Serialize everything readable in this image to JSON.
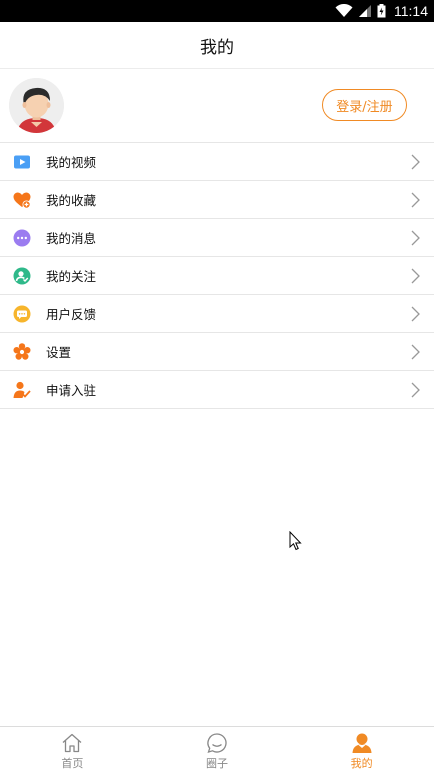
{
  "status_bar": {
    "time": "11:14"
  },
  "header": {
    "title": "我的"
  },
  "profile": {
    "login_label": "登录/注册"
  },
  "menu": {
    "items": [
      {
        "label": "我的视频",
        "icon": "video-play-icon",
        "color": "#4a9ff5"
      },
      {
        "label": "我的收藏",
        "icon": "heart-plus-icon",
        "color": "#f5761a"
      },
      {
        "label": "我的消息",
        "icon": "message-dots-icon",
        "color": "#9b7cf0"
      },
      {
        "label": "我的关注",
        "icon": "user-check-icon",
        "color": "#2fb98a"
      },
      {
        "label": "用户反馈",
        "icon": "feedback-bubble-icon",
        "color": "#f7b52c"
      },
      {
        "label": "设置",
        "icon": "flower-gear-icon",
        "color": "#f5761a"
      },
      {
        "label": "申请入驻",
        "icon": "user-apply-icon",
        "color": "#f5761a"
      }
    ]
  },
  "tabbar": {
    "tabs": [
      {
        "label": "首页",
        "icon": "home-icon",
        "active": false
      },
      {
        "label": "圈子",
        "icon": "chat-circle-icon",
        "active": false
      },
      {
        "label": "我的",
        "icon": "person-icon",
        "active": true
      }
    ]
  },
  "colors": {
    "accent": "#f08a24",
    "inactive": "#888888"
  }
}
